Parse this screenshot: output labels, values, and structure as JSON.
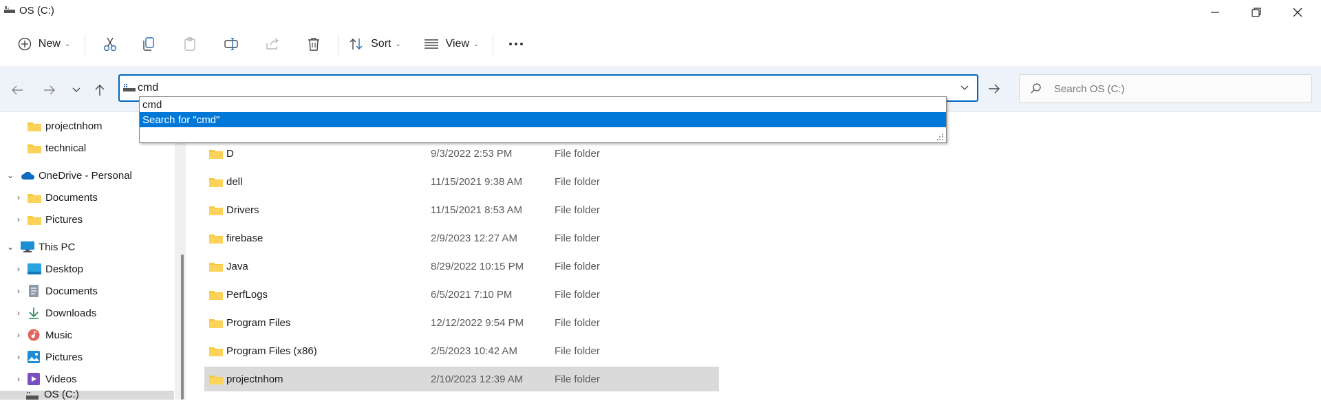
{
  "window": {
    "title": "OS (C:)"
  },
  "toolbar": {
    "new_label": "New",
    "sort_label": "Sort",
    "view_label": "View"
  },
  "address": {
    "value": "cmd"
  },
  "search": {
    "placeholder": "Search OS (C:)"
  },
  "autocomplete": {
    "items": [
      {
        "label": "cmd"
      },
      {
        "label": "Search for \"cmd\""
      }
    ]
  },
  "sidebar": {
    "items": [
      {
        "label": "projectnhom",
        "icon": "folder-icon"
      },
      {
        "label": "technical",
        "icon": "folder-icon"
      },
      {
        "label": "OneDrive - Personal",
        "icon": "cloud-icon"
      },
      {
        "label": "Documents",
        "icon": "folder-icon"
      },
      {
        "label": "Pictures",
        "icon": "folder-icon"
      },
      {
        "label": "This PC",
        "icon": "pc-icon"
      },
      {
        "label": "Desktop",
        "icon": "desktop-icon"
      },
      {
        "label": "Documents",
        "icon": "documents-icon"
      },
      {
        "label": "Downloads",
        "icon": "download-icon"
      },
      {
        "label": "Music",
        "icon": "music-icon"
      },
      {
        "label": "Pictures",
        "icon": "pictures-icon"
      },
      {
        "label": "Videos",
        "icon": "videos-icon"
      },
      {
        "label": "OS (C:)",
        "icon": "drive-icon"
      }
    ]
  },
  "files": [
    {
      "name": "D",
      "date": "9/3/2022 2:53 PM",
      "type": "File folder"
    },
    {
      "name": "dell",
      "date": "11/15/2021 9:38 AM",
      "type": "File folder"
    },
    {
      "name": "Drivers",
      "date": "11/15/2021 8:53 AM",
      "type": "File folder"
    },
    {
      "name": "firebase",
      "date": "2/9/2023 12:27 AM",
      "type": "File folder"
    },
    {
      "name": "Java",
      "date": "8/29/2022 10:15 PM",
      "type": "File folder"
    },
    {
      "name": "PerfLogs",
      "date": "6/5/2021 7:10 PM",
      "type": "File folder"
    },
    {
      "name": "Program Files",
      "date": "12/12/2022 9:54 PM",
      "type": "File folder"
    },
    {
      "name": "Program Files (x86)",
      "date": "2/5/2023 10:42 AM",
      "type": "File folder"
    },
    {
      "name": "projectnhom",
      "date": "2/10/2023 12:39 AM",
      "type": "File folder"
    }
  ],
  "colors": {
    "accent": "#0067c0",
    "selection": "#0078d7",
    "folder": "#f8c93c",
    "selected_row": "#dadada"
  }
}
